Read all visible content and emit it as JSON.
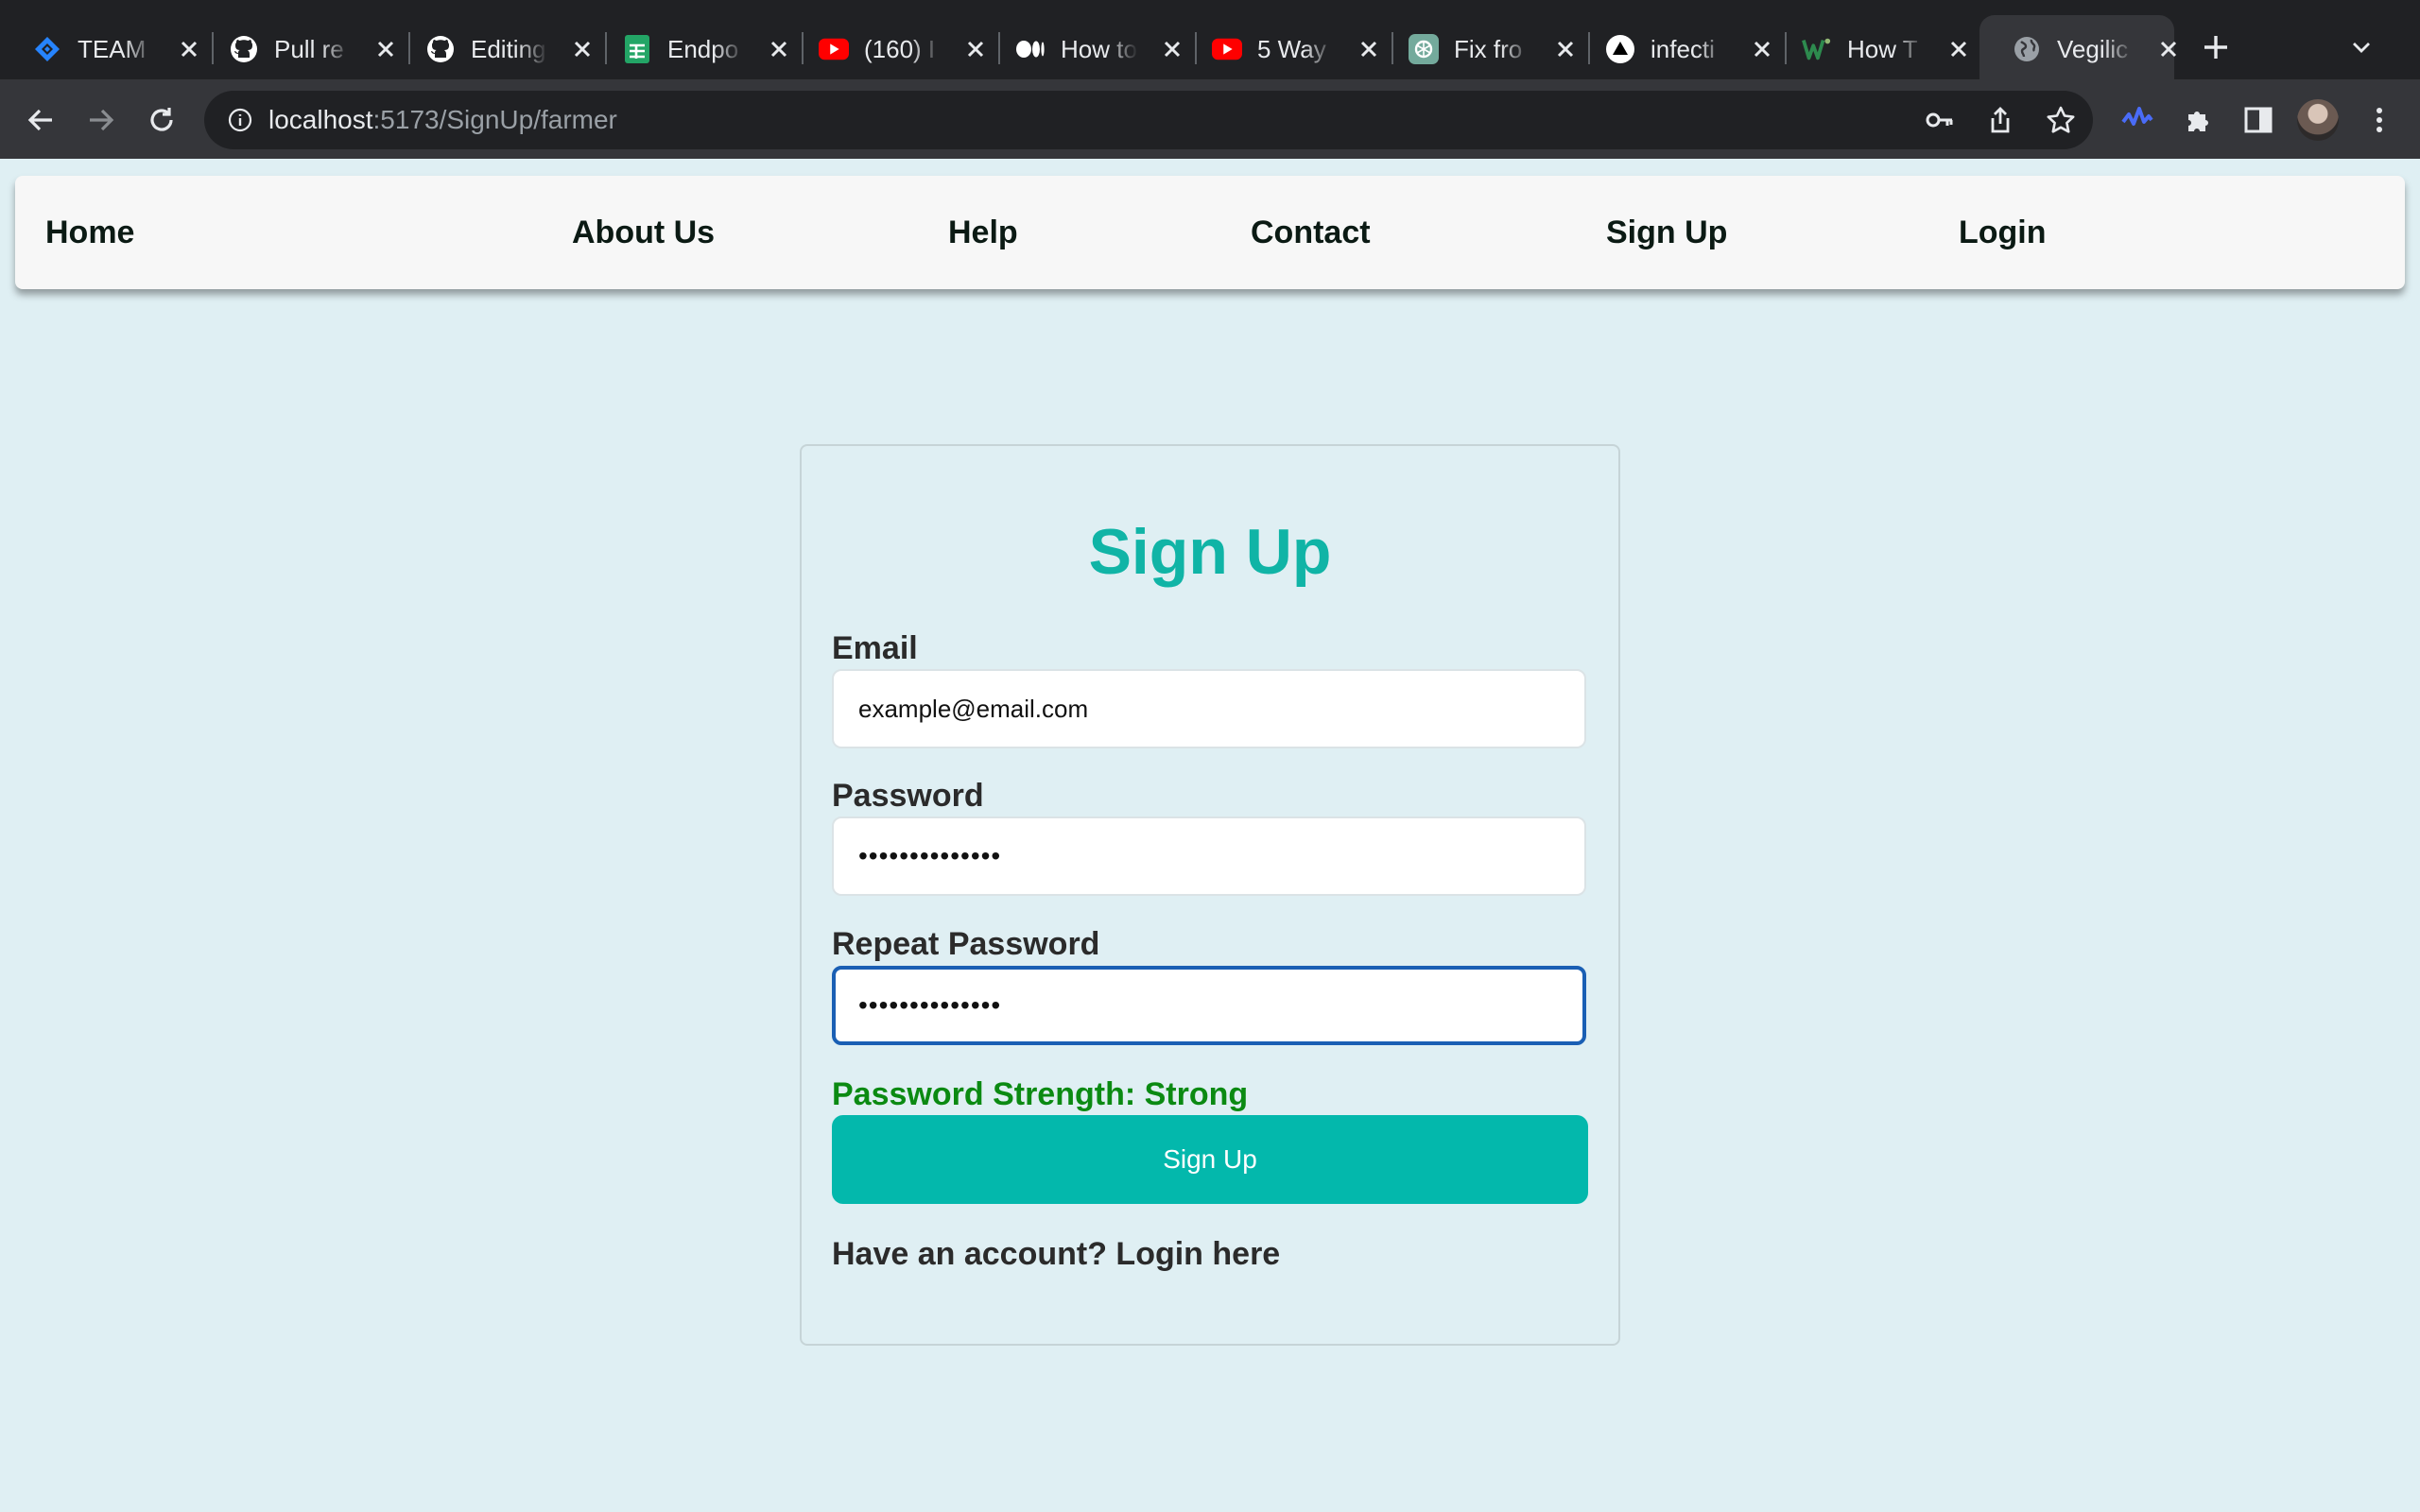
{
  "browser": {
    "tabs": [
      {
        "title": "TEAM",
        "icon": "jira-icon",
        "icon_color": "#2684ff",
        "active": false
      },
      {
        "title": "Pull re",
        "icon": "github-icon",
        "icon_color": "#ffffff",
        "active": false
      },
      {
        "title": "Editing",
        "icon": "github-icon",
        "icon_color": "#ffffff",
        "active": false
      },
      {
        "title": "Endpo",
        "icon": "sheets-icon",
        "icon_color": "#23a566",
        "active": false
      },
      {
        "title": "(160) I",
        "icon": "youtube-icon",
        "icon_color": "#ff0000",
        "active": false
      },
      {
        "title": "How to",
        "icon": "medium-icon",
        "icon_color": "#ffffff",
        "active": false
      },
      {
        "title": "5 Way",
        "icon": "youtube-icon",
        "icon_color": "#ff0000",
        "active": false
      },
      {
        "title": "Fix fro",
        "icon": "chatgpt-icon",
        "icon_color": "#74aa9c",
        "active": false
      },
      {
        "title": "infecti",
        "icon": "vercel-icon",
        "icon_color": "#ffffff",
        "active": false
      },
      {
        "title": "How T",
        "icon": "wikihow-icon",
        "icon_color": "#93b874",
        "active": false
      },
      {
        "title": "Vegilic",
        "icon": "globe-icon",
        "icon_color": "#9aa0a6",
        "active": true
      }
    ],
    "url_host": "localhost",
    "url_path": ":5173/SignUp/farmer"
  },
  "nav": {
    "home": "Home",
    "about": "About Us",
    "help": "Help",
    "contact": "Contact",
    "signup": "Sign Up",
    "login": "Login"
  },
  "form": {
    "title": "Sign Up",
    "email_label": "Email",
    "email_value": "example@email.com",
    "password_label": "Password",
    "password_value": "••••••••••••••",
    "repeat_label": "Repeat Password",
    "repeat_value": "••••••••••••••",
    "strength": "Password Strength: Strong",
    "submit_label": "Sign Up",
    "login_prompt": "Have an account? Login here"
  },
  "colors": {
    "page_bg": "#dfeff3",
    "accent": "#03b8ac",
    "title": "#10b4a6",
    "strength_ok": "#0b8a12",
    "focus": "#1a5fb4"
  }
}
